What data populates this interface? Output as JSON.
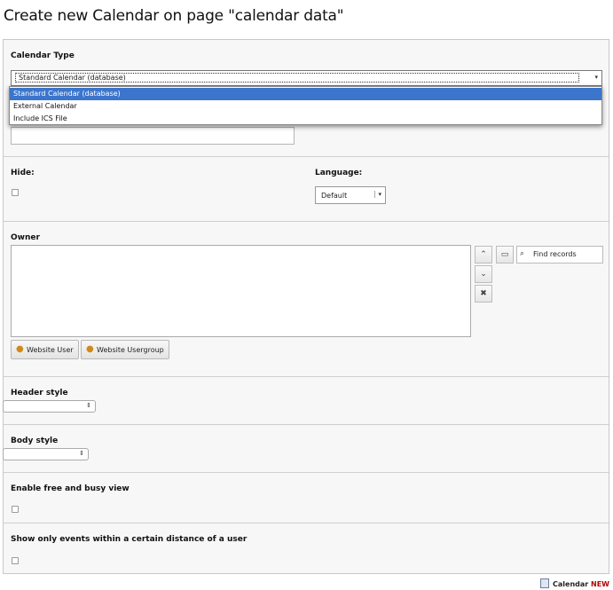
{
  "page": {
    "title": "Create new Calendar on page \"calendar data\""
  },
  "calendar_type": {
    "label": "Calendar Type",
    "selected": "Standard Calendar (database)",
    "options": [
      "Standard Calendar (database)",
      "External Calendar",
      "Include ICS File"
    ]
  },
  "hide": {
    "label": "Hide:"
  },
  "language": {
    "label": "Language:",
    "selected": "Default"
  },
  "owner": {
    "label": "Owner",
    "find_placeholder": "Find records",
    "website_user_button": "Website User",
    "website_usergroup_button": "Website Usergroup"
  },
  "header_style": {
    "label": "Header style"
  },
  "body_style": {
    "label": "Body style"
  },
  "free_busy": {
    "label": "Enable free and busy view"
  },
  "distance": {
    "label": "Show only events within a certain distance of a user"
  },
  "footer": {
    "label": "Calendar",
    "new": "NEW"
  },
  "colors": {
    "selected_option": "#3b75cc",
    "new_badge": "#b00000"
  },
  "icons": [
    "chevron-up-icon",
    "chevron-down-icon",
    "delete-icon",
    "folder-icon",
    "search-icon",
    "user-icon",
    "usergroup-icon",
    "calendar-icon"
  ]
}
